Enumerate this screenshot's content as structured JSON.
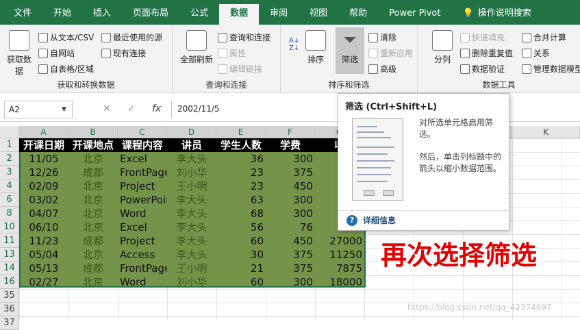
{
  "tabs": [
    "文件",
    "开始",
    "插入",
    "页面布局",
    "公式",
    "数据",
    "审阅",
    "视图",
    "帮助",
    "Power Pivot",
    "操作说明搜索"
  ],
  "ribbon": {
    "get_data": "获取数\n据",
    "from_text": "从文本/CSV",
    "from_web": "自网站",
    "from_table": "自表格/区域",
    "recent_sources": "最近使用的源",
    "existing_conn": "现有连接",
    "group1": "获取和转换数据",
    "refresh_all": "全部刷新",
    "queries": "查询和连接",
    "properties": "属性",
    "edit_links": "编辑链接",
    "group2": "查询和连接",
    "sort": "排序",
    "filter": "筛选",
    "clear": "清除",
    "reapply": "重新应用",
    "advanced": "高级",
    "group3": "排序和筛选",
    "text_to_cols": "分列",
    "flash_fill": "快速填充",
    "remove_dup": "删除重复值",
    "data_validation": "数据验证",
    "consolidate": "合并计算",
    "relationships": "关系",
    "data_model": "管理数据模型",
    "group4": "数据工具"
  },
  "formula_bar": {
    "name_box": "A2",
    "formula": "2002/11/5"
  },
  "columns": [
    "A",
    "B",
    "C",
    "D",
    "E",
    "F",
    "G",
    "H",
    "I",
    "J",
    "K"
  ],
  "headers": [
    "开课日期",
    "开课地点",
    "课程内容",
    "讲员",
    "学生人数",
    "学费",
    "收"
  ],
  "rows": [
    {
      "n": "1",
      "hdr": true
    },
    {
      "n": "2",
      "a": "11/05",
      "b": "北京",
      "c": "Excel",
      "d": "李大头",
      "e": "36",
      "f": "300",
      "g": "1"
    },
    {
      "n": "3",
      "a": "12/26",
      "b": "成都",
      "c": "FrontPage",
      "d": "刘小华",
      "e": "23",
      "f": "375",
      "g": ""
    },
    {
      "n": "4",
      "a": "02/09",
      "b": "北京",
      "c": "Project",
      "d": "王小明",
      "e": "23",
      "f": "450",
      "g": "1"
    },
    {
      "n": "6",
      "a": "03/02",
      "b": "北京",
      "c": "PowerPoint",
      "d": "李大头",
      "e": "63",
      "f": "300",
      "g": "1"
    },
    {
      "n": "8",
      "a": "04/07",
      "b": "北京",
      "c": "Word",
      "d": "李大头",
      "e": "68",
      "f": "300",
      "g": "2"
    },
    {
      "n": "10",
      "a": "06/10",
      "b": "北京",
      "c": "Excel",
      "d": "李大头",
      "e": "56",
      "f": "76",
      "g": ""
    },
    {
      "n": "11",
      "a": "11/23",
      "b": "成都",
      "c": "Project",
      "d": "李大头",
      "e": "60",
      "f": "450",
      "g": "27000"
    },
    {
      "n": "13",
      "a": "05/04",
      "b": "北京",
      "c": "Access",
      "d": "李大头",
      "e": "30",
      "f": "375",
      "g": "11250"
    },
    {
      "n": "14",
      "a": "05/13",
      "b": "成都",
      "c": "FrontPage",
      "d": "王小明",
      "e": "21",
      "f": "375",
      "g": "7875"
    },
    {
      "n": "16",
      "a": "02/27",
      "b": "北京",
      "c": "Word",
      "d": "刘小华",
      "e": "60",
      "f": "300",
      "g": "18000"
    },
    {
      "n": "35"
    },
    {
      "n": "36"
    },
    {
      "n": "37"
    }
  ],
  "tooltip": {
    "title": "筛选 (Ctrl+Shift+L)",
    "text1": "对所选单元格启用筛选。",
    "text2": "然后，单击列标题中的箭头以缩小数据范围。",
    "more": "详细信息"
  },
  "overlay_text": "再次选择筛选",
  "watermark": "https://blog.csdn.net/qq_42374697"
}
